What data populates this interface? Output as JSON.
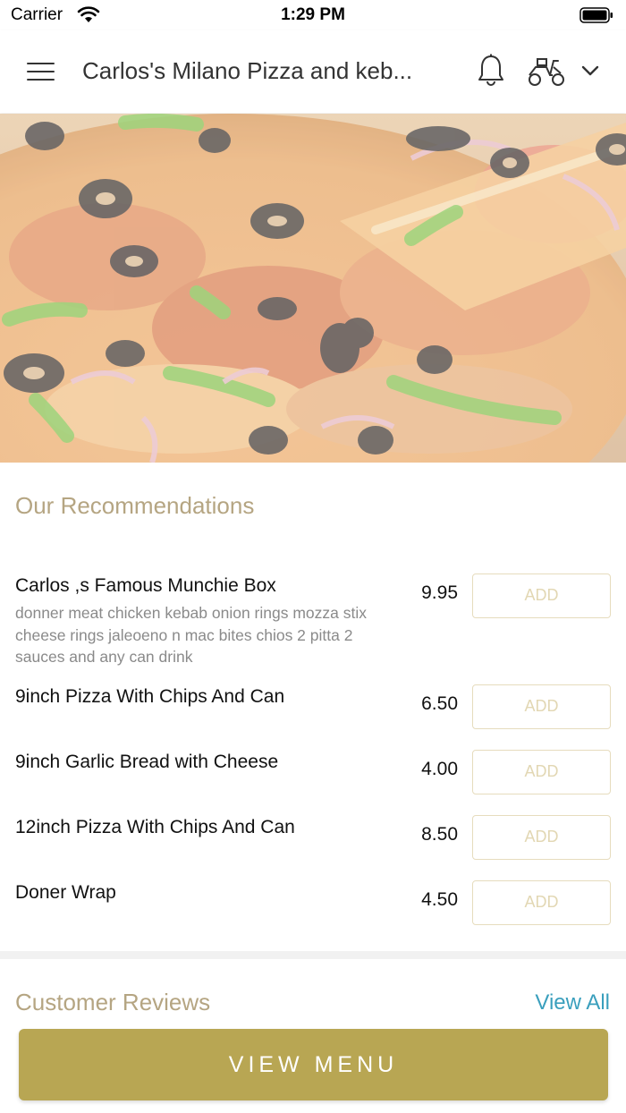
{
  "status_bar": {
    "carrier": "Carrier",
    "time": "1:29 PM"
  },
  "header": {
    "title": "Carlos's Milano Pizza and keb...",
    "icons": [
      "menu-icon",
      "bell-icon",
      "scooter-icon",
      "chevron-down-icon"
    ]
  },
  "hero": {
    "alt": "pizza-photo"
  },
  "recommendations": {
    "title": "Our Recommendations",
    "add_label": "ADD",
    "items": [
      {
        "name": "Carlos ,s Famous Munchie Box",
        "desc": "donner meat chicken kebab onion rings mozza stix cheese rings  jaleoeno n mac bites chios 2 pitta 2 sauces and any can drink",
        "price": "9.95"
      },
      {
        "name": "9inch Pizza With Chips And Can",
        "desc": "",
        "price": "6.50"
      },
      {
        "name": "9inch Garlic Bread with Cheese",
        "desc": "",
        "price": "4.00"
      },
      {
        "name": "12inch Pizza With Chips And Can",
        "desc": "",
        "price": "8.50"
      },
      {
        "name": "Doner Wrap",
        "desc": "",
        "price": "4.50"
      }
    ]
  },
  "reviews": {
    "title": "Customer Reviews",
    "view_all": "View All"
  },
  "footer": {
    "view_menu": "VIEW MENU"
  },
  "colors": {
    "accent": "#b8a653",
    "section_title": "#b5a582",
    "link": "#3a9fbd",
    "add_border": "#e6dcbd"
  }
}
